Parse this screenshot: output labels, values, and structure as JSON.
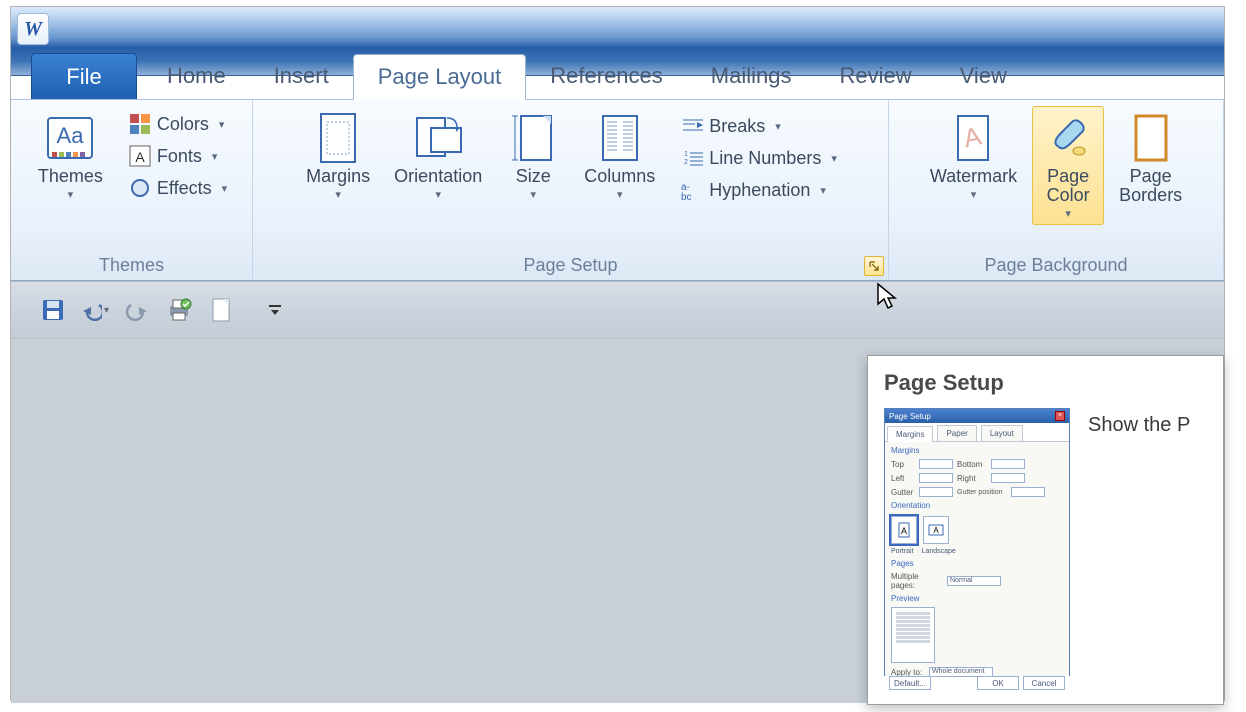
{
  "app": {
    "logo_letter": "W"
  },
  "tabs": {
    "file": "File",
    "items": [
      "Home",
      "Insert",
      "Page Layout",
      "References",
      "Mailings",
      "Review",
      "View"
    ],
    "active_index": 2
  },
  "ribbon": {
    "themes": {
      "group_label": "Themes",
      "themes_btn": "Themes",
      "colors": "Colors",
      "fonts": "Fonts",
      "effects": "Effects"
    },
    "page_setup": {
      "group_label": "Page Setup",
      "margins": "Margins",
      "orientation": "Orientation",
      "size": "Size",
      "columns": "Columns",
      "breaks": "Breaks",
      "line_numbers": "Line Numbers",
      "hyphenation": "Hyphenation"
    },
    "page_background": {
      "group_label": "Page Background",
      "watermark": "Watermark",
      "page_color": "Page\nColor",
      "page_borders": "Page\nBorders"
    }
  },
  "tooltip": {
    "title": "Page Setup",
    "description": "Show the P",
    "dialog": {
      "title": "Page Setup",
      "tabs": [
        "Margins",
        "Paper",
        "Layout"
      ],
      "active_tab": 0,
      "margins_label": "Margins",
      "fields": [
        "Top",
        "Left",
        "Gutter",
        "Bottom",
        "Right",
        "Gutter position"
      ],
      "orientation_label": "Orientation",
      "portrait": "Portrait",
      "landscape": "Landscape",
      "pages_label": "Pages",
      "multiple_pages": "Multiple pages:",
      "multiple_pages_value": "Normal",
      "preview_label": "Preview",
      "apply_label": "Apply to:",
      "apply_value": "Whole document",
      "default_btn": "Default...",
      "ok_btn": "OK",
      "cancel_btn": "Cancel"
    }
  },
  "icons": {
    "caret": "▾",
    "caret_small": "▼"
  }
}
